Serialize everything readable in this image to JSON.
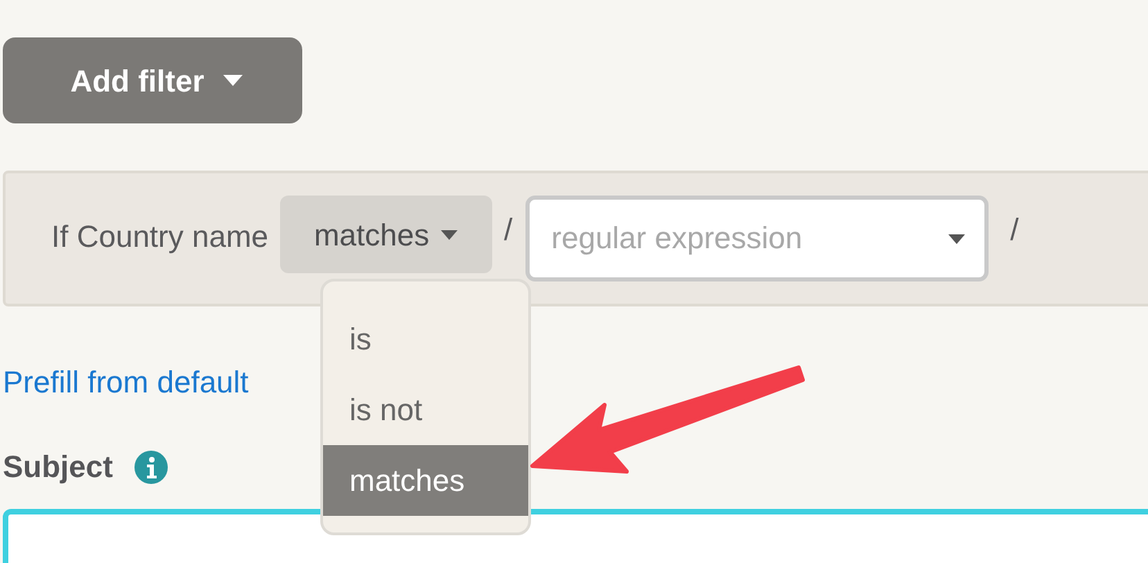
{
  "add_filter_button": {
    "label": "Add filter"
  },
  "filter": {
    "label": "If Country name",
    "operator": "matches",
    "separator_before": "/",
    "value_field": {
      "placeholder": "regular expression"
    },
    "separator_after": "/"
  },
  "operator_menu": {
    "items": [
      {
        "label": "is",
        "selected": false
      },
      {
        "label": "is not",
        "selected": false
      },
      {
        "label": "matches",
        "selected": true
      }
    ]
  },
  "prefill_link": "Prefill from default",
  "subject": {
    "label": "Subject"
  }
}
